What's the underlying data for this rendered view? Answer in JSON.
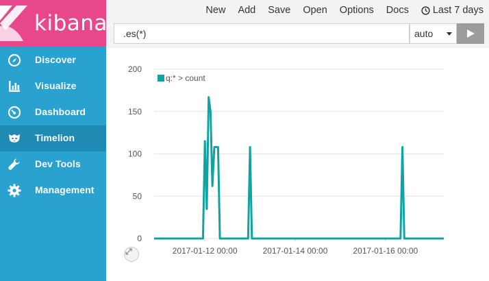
{
  "brand": {
    "name": "kibana",
    "color": "#e8488b"
  },
  "sidebar": {
    "color": "#29a2cf",
    "items": [
      {
        "label": "Discover",
        "icon": "compass-icon",
        "active": false
      },
      {
        "label": "Visualize",
        "icon": "bar-chart-icon",
        "active": false
      },
      {
        "label": "Dashboard",
        "icon": "dashboard-gauge-icon",
        "active": false
      },
      {
        "label": "Timelion",
        "icon": "timelion-lion-icon",
        "active": true
      },
      {
        "label": "Dev Tools",
        "icon": "wrench-icon",
        "active": false
      },
      {
        "label": "Management",
        "icon": "gear-icon",
        "active": false
      }
    ]
  },
  "toolbar": {
    "new_label": "New",
    "add_label": "Add",
    "save_label": "Save",
    "open_label": "Open",
    "options_label": "Options",
    "docs_label": "Docs",
    "time_range_label": "Last 7 days"
  },
  "query": {
    "expression": ".es(*)",
    "interval": "auto"
  },
  "chart_data": {
    "type": "line",
    "title": "",
    "xlabel": "",
    "ylabel": "",
    "ylim": [
      0,
      200
    ],
    "yticks": [
      "0",
      "50",
      "100",
      "150",
      "200"
    ],
    "xticks": [
      "2017-01-12 00:00",
      "2017-01-14 00:00",
      "2017-01-16 00:00"
    ],
    "grid": true,
    "legend_position": "top-left",
    "series": [
      {
        "name": "q:* > count",
        "color": "#10a3a3",
        "points": [
          [
            "2017-01-10 21:00",
            0
          ],
          [
            "2017-01-11 21:00",
            0
          ],
          [
            "2017-01-11 23:00",
            0
          ],
          [
            "2017-01-12 00:00",
            115
          ],
          [
            "2017-01-12 01:00",
            35
          ],
          [
            "2017-01-12 02:00",
            167
          ],
          [
            "2017-01-12 03:00",
            150
          ],
          [
            "2017-01-12 04:00",
            62
          ],
          [
            "2017-01-12 05:00",
            108
          ],
          [
            "2017-01-12 06:00",
            108
          ],
          [
            "2017-01-12 07:00",
            108
          ],
          [
            "2017-01-12 08:00",
            0
          ],
          [
            "2017-01-12 23:00",
            0
          ],
          [
            "2017-01-13 00:00",
            108
          ],
          [
            "2017-01-13 01:00",
            0
          ],
          [
            "2017-01-16 08:00",
            0
          ],
          [
            "2017-01-16 09:00",
            108
          ],
          [
            "2017-01-16 10:00",
            0
          ],
          [
            "2017-01-17 07:00",
            0
          ]
        ]
      }
    ]
  }
}
